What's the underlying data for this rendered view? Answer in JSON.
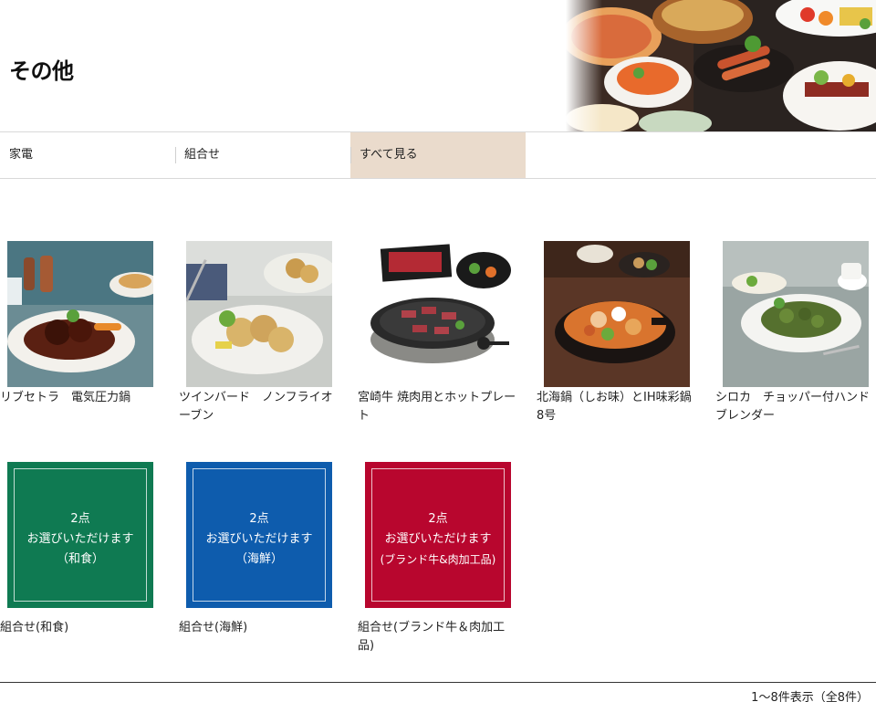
{
  "header": {
    "title": "その他"
  },
  "tabs": [
    {
      "label": "家電",
      "active": false
    },
    {
      "label": "組合せ",
      "active": false
    },
    {
      "label": "すべて見る",
      "active": true
    }
  ],
  "products": [
    {
      "title": "リブセトラ　電気圧力鍋",
      "image": "stew-photo"
    },
    {
      "title": "ツインバード　ノンフライオーブン",
      "image": "fried-chicken-photo"
    },
    {
      "title": "宮崎牛 焼肉用とホットプレート",
      "image": "hot-plate-photo"
    },
    {
      "title": "北海鍋（しお味）とIH味彩鍋8号",
      "image": "hot-pot-photo"
    },
    {
      "title": "シロカ　チョッパー付ハンドブレンダー",
      "image": "pasta-photo"
    }
  ],
  "combos": [
    {
      "title": "組合せ(和食)",
      "line1": "2点",
      "line2": "お選びいただけます",
      "line3": "（和食）",
      "color": "#0f7a52"
    },
    {
      "title": "組合せ(海鮮)",
      "line1": "2点",
      "line2": "お選びいただけます",
      "line3": "（海鮮）",
      "color": "#0e5cad"
    },
    {
      "title": "組合せ(ブランド牛＆肉加工品)",
      "line1": "2点",
      "line2": "お選びいただけます",
      "line3": "(ブランド牛&肉加工品)",
      "color": "#b8062e"
    }
  ],
  "footer": {
    "count": "1～8件表示（全8件）"
  },
  "colors": {
    "active_tab": "#eadbcc"
  }
}
